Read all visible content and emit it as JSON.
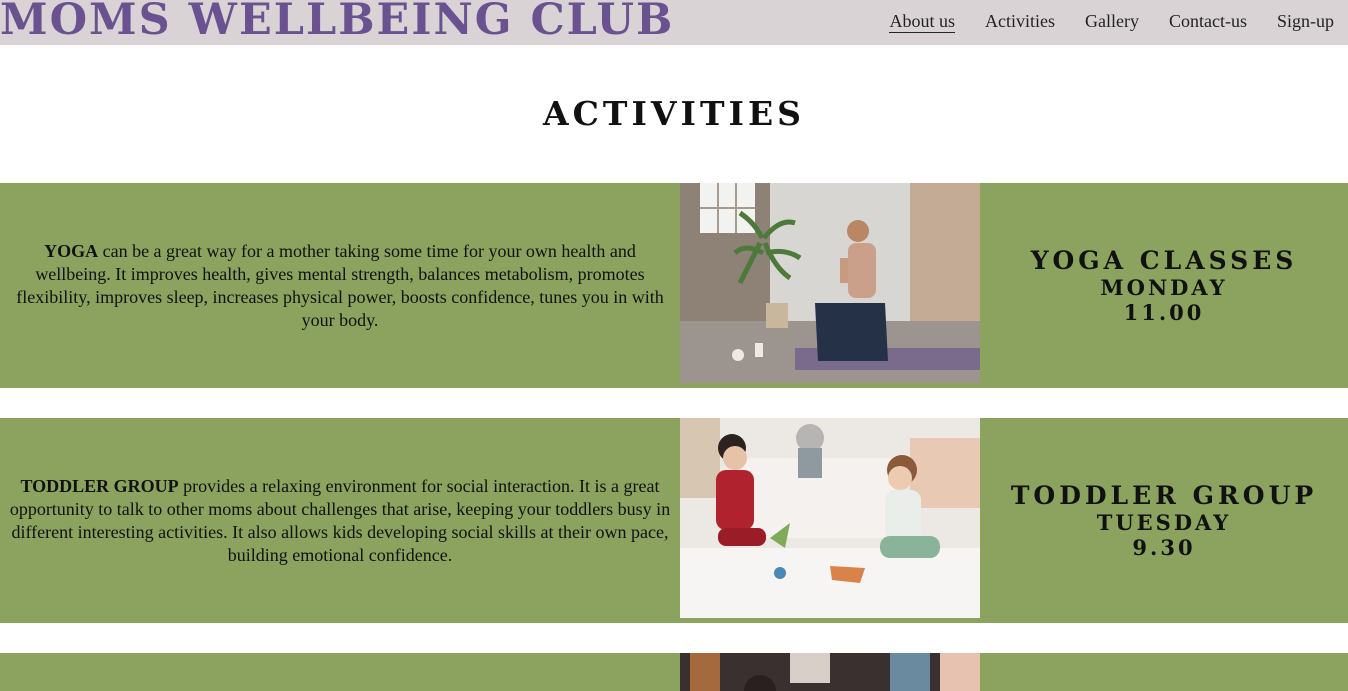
{
  "header": {
    "logo": "MOMS WELLBEING CLUB",
    "nav": [
      {
        "label": "About us",
        "active": true
      },
      {
        "label": "Activities",
        "active": false
      },
      {
        "label": "Gallery",
        "active": false
      },
      {
        "label": "Contact-us",
        "active": false
      },
      {
        "label": "Sign-up",
        "active": false
      }
    ]
  },
  "main": {
    "title": "ACTIVITIES",
    "activities": [
      {
        "lead": "YOGA",
        "text": " can be a great way for a mother taking some time for your own health and wellbeing. It improves health, gives mental strength, balances metabolism, promotes flexibility, improves sleep, increases physical power, boosts confidence, tunes you in with your body.",
        "schedule_title": "YOGA CLASSES",
        "day": "MONDAY",
        "time": "11.00"
      },
      {
        "lead": "TODDLER GROUP",
        "text": " provides a relaxing environment for social interaction. It is a great opportunity to talk to other moms about challenges that arise, keeping your toddlers busy in different interesting activities. It also allows kids developing social skills at their own pace, building emotional confidence.",
        "schedule_title": "TODDLER GROUP",
        "day": "TUESDAY",
        "time": "9.30"
      }
    ]
  },
  "colors": {
    "header_bg": "#d9d3d6",
    "logo": "#6a5290",
    "band_green": "#8ba35e"
  }
}
